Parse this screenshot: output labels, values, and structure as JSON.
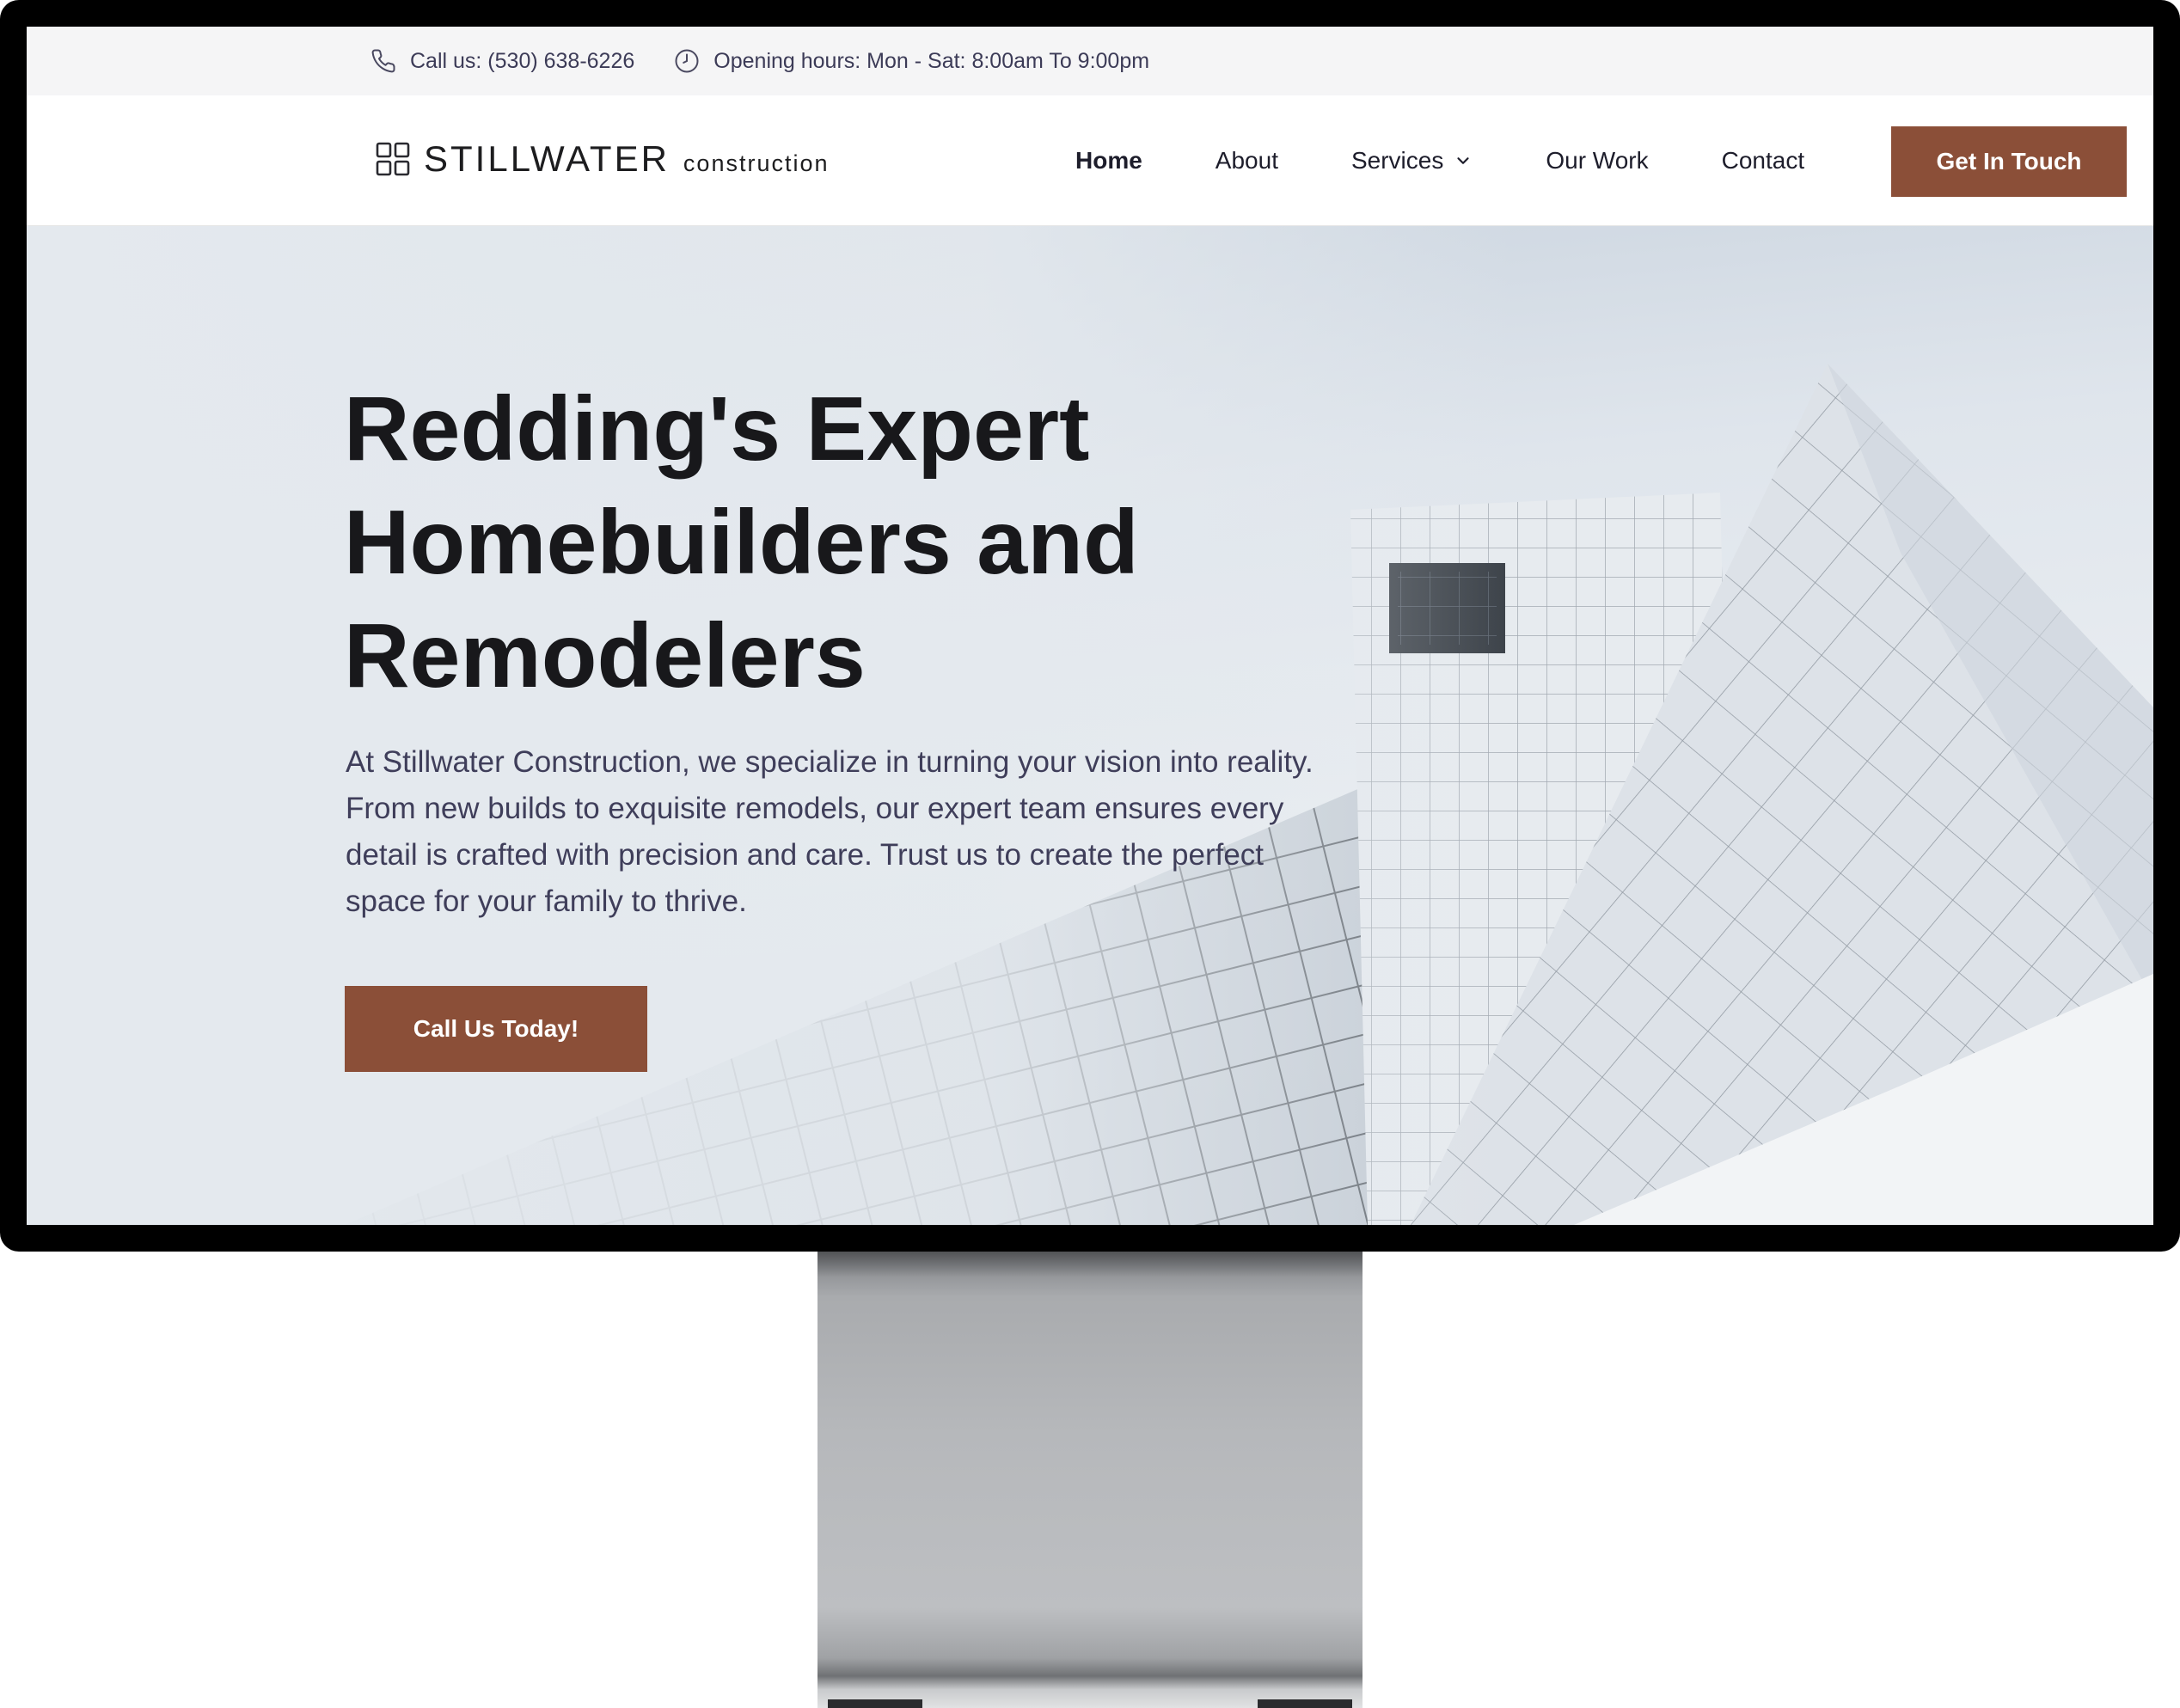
{
  "topbar": {
    "phone": "Call us: (530) 638-6226",
    "hours": "Opening hours: Mon - Sat: 8:00am To 9:00pm",
    "phone_icon": "phone-icon",
    "clock_icon": "clock-icon"
  },
  "brand": {
    "name": "STILLWATER",
    "sub": "construction",
    "icon": "grid-logo-icon"
  },
  "nav": {
    "items": [
      {
        "label": "Home"
      },
      {
        "label": "About"
      },
      {
        "label": "Services"
      },
      {
        "label": "Our Work"
      },
      {
        "label": "Contact"
      }
    ],
    "cta": "Get In Touch"
  },
  "hero": {
    "title": "Redding's Expert Homebuilders and Remodelers",
    "text": "At Stillwater Construction, we specialize in turning your vision into reality. From new builds to exquisite remodels, our expert team ensures every detail is crafted with precision and care. Trust us to create the perfect space for your family to thrive.",
    "cta": "Call Us Today!"
  },
  "colors": {
    "accent": "#8b4f38",
    "text_dark": "#18181b",
    "text_body": "#3f3e5a",
    "topbar_bg": "#f5f5f6"
  }
}
